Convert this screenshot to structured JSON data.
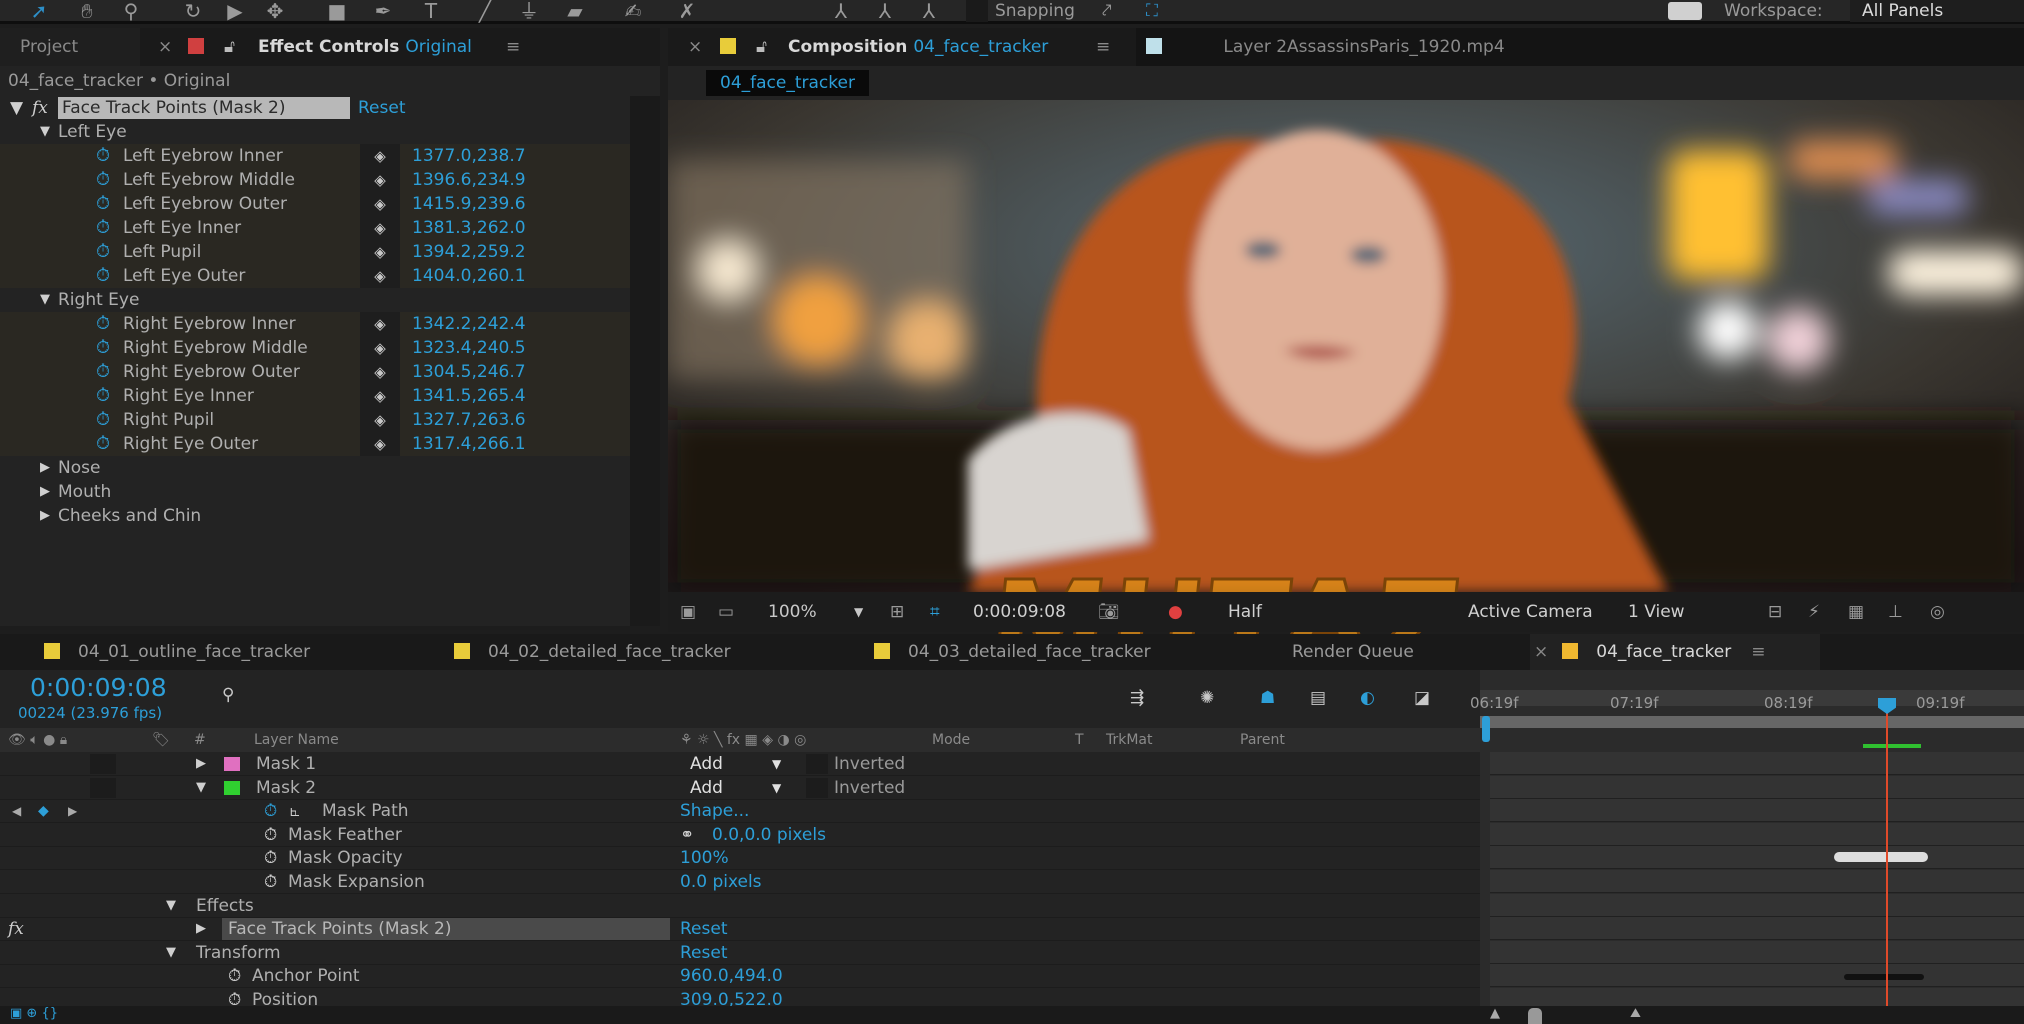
{
  "toolbar": {
    "tools": [
      "selection-tool",
      "hand-tool",
      "zoom-tool",
      "rotate-tool",
      "camera-tool",
      "pan-behind-tool",
      "rectangle-tool",
      "pen-tool",
      "type-tool",
      "brush-tool",
      "clone-stamp-tool",
      "eraser-tool",
      "roto-brush-tool",
      "puppet-pin-tool"
    ],
    "snapping_label": "Snapping",
    "workspace_label": "Workspace:",
    "workspace_value": "All Panels"
  },
  "left_panel": {
    "project_tab": "Project",
    "effect_tab_prefix": "Effect Controls",
    "effect_tab_layer": "Original",
    "breadcrumb": "04_face_tracker • Original",
    "effect_name": "Face Track Points (Mask 2)",
    "reset_label": "Reset",
    "groups": [
      {
        "name": "Left Eye",
        "expanded": true,
        "points": [
          {
            "name": "Left Eyebrow Inner",
            "value": "1377.0,238.7"
          },
          {
            "name": "Left Eyebrow Middle",
            "value": "1396.6,234.9"
          },
          {
            "name": "Left Eyebrow Outer",
            "value": "1415.9,239.6"
          },
          {
            "name": "Left Eye Inner",
            "value": "1381.3,262.0"
          },
          {
            "name": "Left Pupil",
            "value": "1394.2,259.2"
          },
          {
            "name": "Left Eye Outer",
            "value": "1404.0,260.1"
          }
        ]
      },
      {
        "name": "Right Eye",
        "expanded": true,
        "points": [
          {
            "name": "Right Eyebrow Inner",
            "value": "1342.2,242.4"
          },
          {
            "name": "Right Eyebrow Middle",
            "value": "1323.4,240.5"
          },
          {
            "name": "Right Eyebrow Outer",
            "value": "1304.5,246.7"
          },
          {
            "name": "Right Eye Inner",
            "value": "1341.5,265.4"
          },
          {
            "name": "Right Pupil",
            "value": "1327.7,263.6"
          },
          {
            "name": "Right Eye Outer",
            "value": "1317.4,266.1"
          }
        ]
      },
      {
        "name": "Nose",
        "expanded": false,
        "points": []
      },
      {
        "name": "Mouth",
        "expanded": false,
        "points": []
      },
      {
        "name": "Cheeks and Chin",
        "expanded": false,
        "points": []
      }
    ]
  },
  "composition": {
    "tab_prefix": "Composition",
    "tab_comp": "04_face_tracker",
    "layer_tab": "Layer 2AssassinsParis_1920.mp4",
    "flow_chip": "04_face_tracker",
    "zoom_level": "100%",
    "timecode": "0:00:09:08",
    "resolution": "Half",
    "camera": "Active Camera",
    "views": "1 View"
  },
  "timeline_tabs": [
    {
      "label": "04_01_outline_face_tracker",
      "color": "#e8cc3a"
    },
    {
      "label": "04_02_detailed_face_tracker",
      "color": "#e8cc3a"
    },
    {
      "label": "04_03_detailed_face_tracker",
      "color": "#e8cc3a"
    },
    {
      "label": "Render Queue",
      "color": ""
    },
    {
      "label": "04_face_tracker",
      "color": "#f0b830",
      "active": true
    }
  ],
  "timeline": {
    "current_time": "0:00:09:08",
    "frame_info": "00224 (23.976 fps)",
    "columns": {
      "layer_name": "Layer Name",
      "mode": "Mode",
      "t": "T",
      "trkmat": "TrkMat",
      "parent": "Parent"
    },
    "ruler_labels": [
      "06:19f",
      "07:19f",
      "08:19f",
      "09:19f"
    ],
    "rows": [
      {
        "type": "mask",
        "name": "Mask 1",
        "color": "#e070c0",
        "mode": "Add",
        "inverted": "Inverted",
        "expanded": false
      },
      {
        "type": "mask",
        "name": "Mask 2",
        "color": "#30d030",
        "mode": "Add",
        "inverted": "Inverted",
        "expanded": true
      },
      {
        "type": "prop",
        "name": "Mask Path",
        "value": "Shape...",
        "animated": true
      },
      {
        "type": "prop",
        "name": "Mask Feather",
        "value": "0.0,0.0 pixels"
      },
      {
        "type": "prop",
        "name": "Mask Opacity",
        "value": "100%"
      },
      {
        "type": "prop",
        "name": "Mask Expansion",
        "value": "0.0 pixels"
      },
      {
        "type": "group",
        "name": "Effects"
      },
      {
        "type": "effect",
        "name": "Face Track Points (Mask 2)",
        "value": "Reset"
      },
      {
        "type": "group",
        "name": "Transform",
        "value": "Reset"
      },
      {
        "type": "prop",
        "name": "Anchor Point",
        "value": "960.0,494.0"
      },
      {
        "type": "prop",
        "name": "Position",
        "value": "309.0,522.0"
      }
    ]
  },
  "watermark": "MUTAZ"
}
